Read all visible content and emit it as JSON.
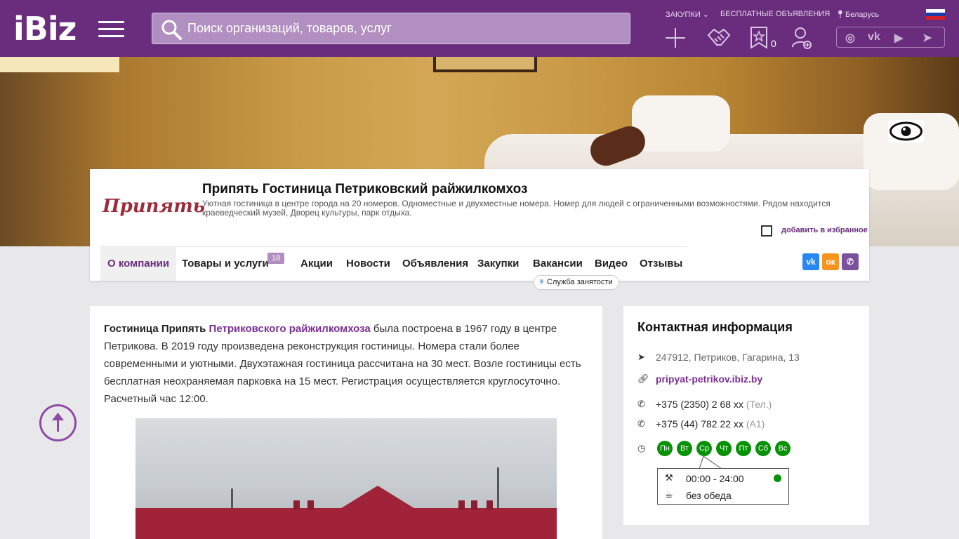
{
  "header": {
    "logo": "iBiz",
    "search_placeholder": "Поиск организаций, товаров, услуг",
    "links": {
      "zakupki": "Закупки",
      "ads": "Бесплатные объявления",
      "region": "Беларусь"
    },
    "favorites_count": "0"
  },
  "company": {
    "logo_text": "Припять",
    "title": "Припять Гостиница Петриковский райжилкомхоз",
    "description": "Уютная гостиница в центре города на 20 номеров. Одноместные и двухместные номера. Номер для людей с ограниченными возможностями. Рядом находится краеведческий музей, Дворец культуры, парк отдыха.",
    "add_favorite": "добавить в избранное",
    "tabs": [
      "О компании",
      "Товары и услуги",
      "Акции",
      "Новости",
      "Объявления",
      "Закупки",
      "Вакансии",
      "Видео",
      "Отзывы"
    ],
    "products_badge": "18",
    "job_tip": "Служба занятости"
  },
  "about": {
    "lead_bold": "Гостиница Припять",
    "lead_link": "Петриковского райжилкомхоза",
    "text": " была построена в 1967 году в центре Петрикова. В 2019 году произведена реконструкция гостиницы. Номера стали более современными и уютными. Двухэтажная гостиница рассчитана на 30 мест. Возле гостиницы есть бесплатная неохраняемая парковка на 15 мест. Регистрация осуществляется круглосуточно. Расчетный час 12:00."
  },
  "contacts": {
    "title": "Контактная информация",
    "address": "247912, Петриков, Гагарина, 13",
    "site": "pripyat-petrikov.ibiz.by",
    "phone1": "+375 (2350) 2 68 xx",
    "phone1_note": "(Тел.)",
    "phone2": "+375 (44) 782 22 xx",
    "phone2_note": "(A1)",
    "days": [
      "Пн",
      "Вт",
      "Ср",
      "Чт",
      "Пт",
      "Сб",
      "Вс"
    ],
    "hours": "00:00 - 24:00",
    "lunch": "без обеда"
  },
  "colors": {
    "brand": "#6a2d7e",
    "link": "#7a2f93",
    "open": "#079105"
  }
}
